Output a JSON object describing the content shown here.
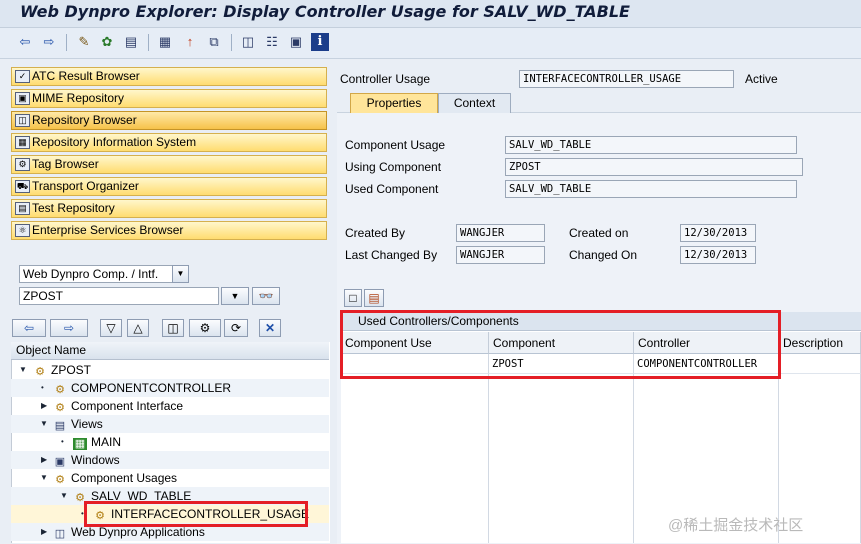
{
  "window": {
    "title": "Web Dynpro Explorer: Display Controller Usage for SALV_WD_TABLE"
  },
  "toolbar": {
    "icons": [
      "back-icon",
      "forward-icon",
      "other-object-icon",
      "activate-icon",
      "display-object-list-icon",
      "where-used-icon",
      "up-icon",
      "navigation-window-icon",
      "object-hierarchy-icon",
      "display-list-icon",
      "info-icon"
    ]
  },
  "navigation": {
    "items": [
      {
        "label": "ATC Result Browser",
        "icon": "atc-icon"
      },
      {
        "label": "MIME Repository",
        "icon": "mime-icon"
      },
      {
        "label": "Repository Browser",
        "icon": "repository-icon",
        "active": true
      },
      {
        "label": "Repository Information System",
        "icon": "info-system-icon"
      },
      {
        "label": "Tag Browser",
        "icon": "tag-icon"
      },
      {
        "label": "Transport Organizer",
        "icon": "truck-icon"
      },
      {
        "label": "Test Repository",
        "icon": "test-icon"
      },
      {
        "label": "Enterprise Services Browser",
        "icon": "services-icon"
      }
    ],
    "object_type_select": "Web Dynpro Comp. / Intf.",
    "object_name_input": "ZPOST"
  },
  "tree": {
    "header": "Object Name",
    "nodes": [
      {
        "label": "ZPOST"
      },
      {
        "label": "COMPONENTCONTROLLER"
      },
      {
        "label": "Component Interface"
      },
      {
        "label": "Views"
      },
      {
        "label": "MAIN"
      },
      {
        "label": "Windows"
      },
      {
        "label": "Component Usages"
      },
      {
        "label": "SALV_WD_TABLE"
      },
      {
        "label": "INTERFACECONTROLLER_USAGE"
      },
      {
        "label": "Web Dynpro Applications"
      }
    ]
  },
  "details": {
    "controller_usage_label": "Controller Usage",
    "controller_usage_value": "INTERFACECONTROLLER_USAGE",
    "status": "Active",
    "tabs": [
      "Properties",
      "Context"
    ],
    "component_usage_label": "Component Usage",
    "component_usage_value": "SALV_WD_TABLE",
    "using_component_label": "Using Component",
    "using_component_value": "ZPOST",
    "used_component_label": "Used Component",
    "used_component_value": "SALV_WD_TABLE",
    "created_by_label": "Created By",
    "created_by_value": "WANGJER",
    "last_changed_by_label": "Last Changed By",
    "last_changed_by_value": "WANGJER",
    "created_on_label": "Created on",
    "created_on_value": "12/30/2013",
    "changed_on_label": "Changed On",
    "changed_on_value": "12/30/2013"
  },
  "grid": {
    "title": "Used Controllers/Components",
    "columns": [
      "Component Use",
      "Component",
      "Controller",
      "Description"
    ],
    "rows": [
      [
        "",
        "ZPOST",
        "COMPONENTCONTROLLER",
        ""
      ]
    ]
  },
  "watermark": "@稀土掘金技术社区",
  "colors": {
    "highlight": "#e41e26",
    "nav_button": "#ffdc70",
    "active_tab": "#ffe59a"
  }
}
